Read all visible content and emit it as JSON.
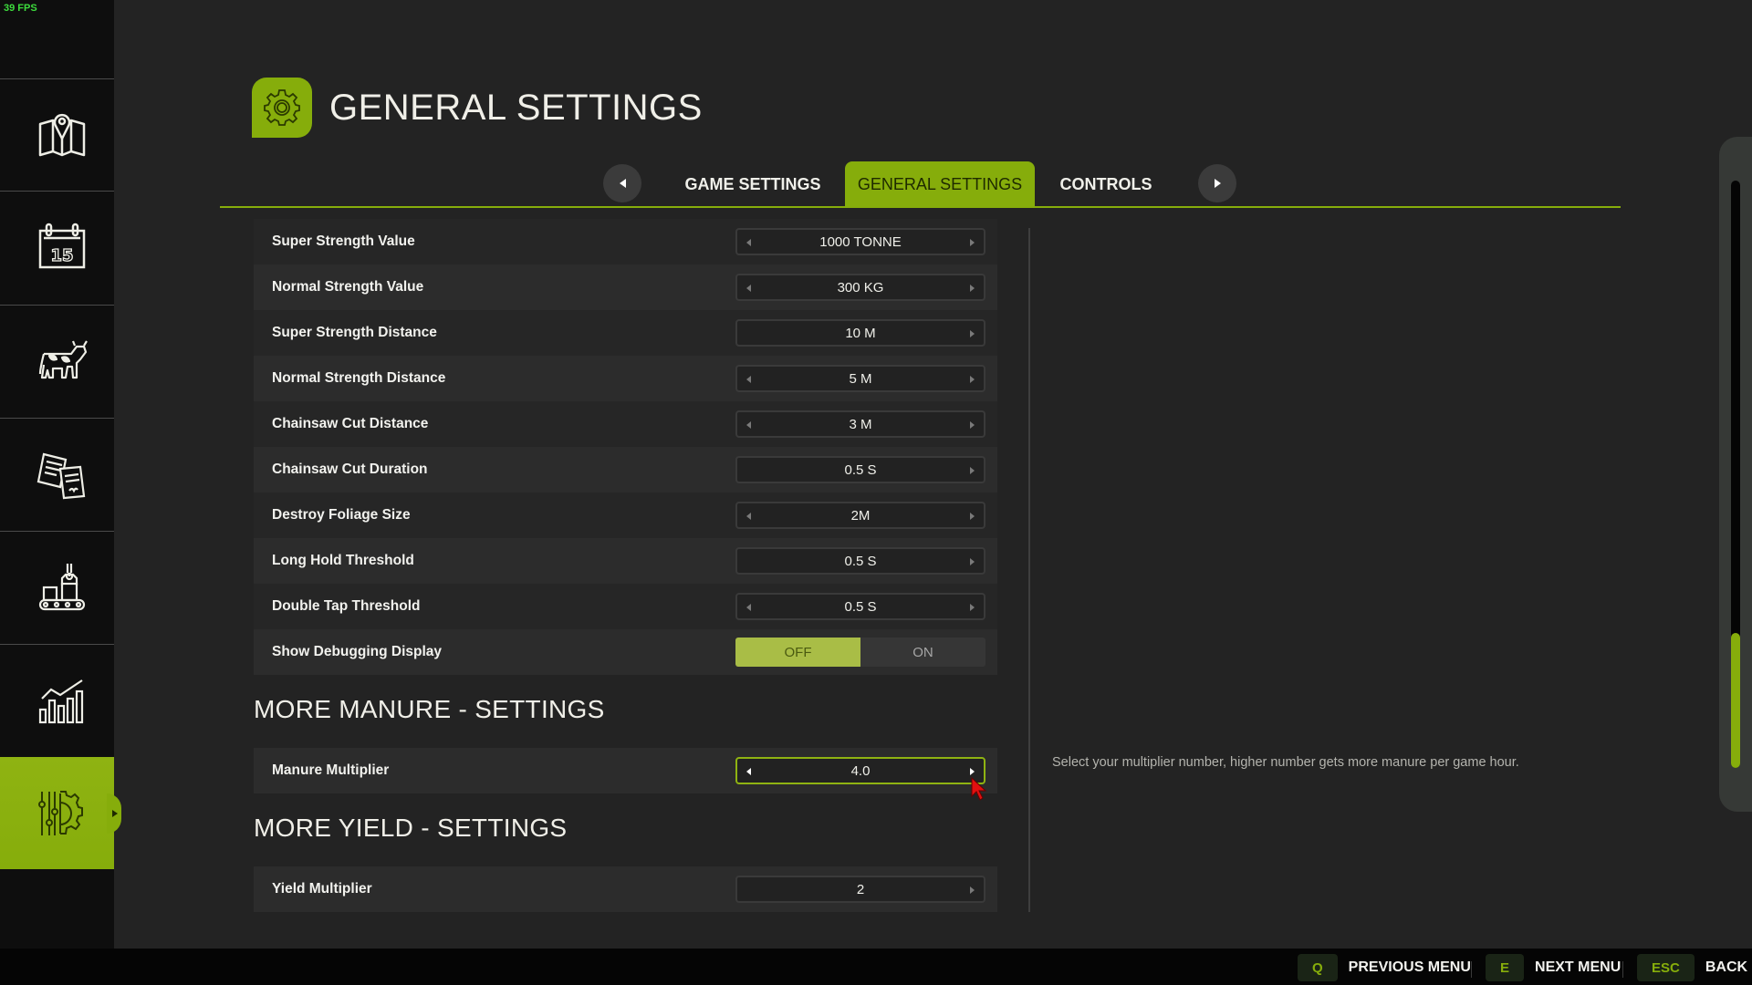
{
  "fps_counter": "39 FPS",
  "sidebar": {
    "items": [
      {
        "name": "map",
        "icon": "map-icon",
        "active": false
      },
      {
        "name": "calendar",
        "icon": "calendar-icon",
        "calendar_day": "15",
        "active": false
      },
      {
        "name": "animals",
        "icon": "cow-icon",
        "active": false
      },
      {
        "name": "contracts",
        "icon": "documents-icon",
        "active": false
      },
      {
        "name": "production",
        "icon": "factory-icon",
        "active": false
      },
      {
        "name": "statistics",
        "icon": "chart-icon",
        "active": false
      },
      {
        "name": "settings",
        "icon": "settings-gear-sliders-icon",
        "active": true
      }
    ]
  },
  "header": {
    "icon": "gear-icon",
    "title": "GENERAL SETTINGS"
  },
  "tabs": {
    "prev_icon": "triangle-left-icon",
    "next_icon": "triangle-right-icon",
    "items": [
      {
        "label": "GAME SETTINGS",
        "active": false
      },
      {
        "label": "GENERAL SETTINGS",
        "active": true
      },
      {
        "label": "CONTROLS",
        "active": false
      }
    ]
  },
  "settings": {
    "rows": [
      {
        "label": "Super Strength Value",
        "value": "1000 TONNE",
        "has_left": true,
        "has_right": true
      },
      {
        "label": "Normal Strength Value",
        "value": "300 KG",
        "has_left": true,
        "has_right": true
      },
      {
        "label": "Super Strength Distance",
        "value": "10 M",
        "has_left": false,
        "has_right": true
      },
      {
        "label": "Normal Strength Distance",
        "value": "5 M",
        "has_left": true,
        "has_right": true
      },
      {
        "label": "Chainsaw Cut Distance",
        "value": "3 M",
        "has_left": true,
        "has_right": true
      },
      {
        "label": "Chainsaw Cut Duration",
        "value": "0.5 S",
        "has_left": false,
        "has_right": true
      },
      {
        "label": "Destroy Foliage Size",
        "value": "2M",
        "has_left": true,
        "has_right": true
      },
      {
        "label": "Long Hold Threshold",
        "value": "0.5 S",
        "has_left": false,
        "has_right": true
      },
      {
        "label": "Double Tap Threshold",
        "value": "0.5 S",
        "has_left": true,
        "has_right": true
      }
    ],
    "debug_toggle": {
      "label": "Show Debugging Display",
      "off_label": "OFF",
      "on_label": "ON",
      "selected": "OFF"
    }
  },
  "manure_section": {
    "title": "MORE MANURE - SETTINGS",
    "row": {
      "label": "Manure Multiplier",
      "value": "4.0",
      "focused": true
    }
  },
  "yield_section": {
    "title": "MORE YIELD - SETTINGS",
    "row": {
      "label": "Yield Multiplier",
      "value": "2"
    }
  },
  "description": "Select your multiplier number, higher number gets more manure per game hour.",
  "scrollbar": {
    "position_fraction": 1.0,
    "visible_fraction": 0.23
  },
  "bottom_bar": {
    "hints": [
      {
        "key": "Q",
        "label": "PREVIOUS MENU"
      },
      {
        "key": "E",
        "label": "NEXT MENU"
      },
      {
        "key": "ESC",
        "label": "BACK"
      }
    ]
  },
  "colors": {
    "accent": "#86ad0b",
    "toggle_selected": "#a9bd46",
    "fps_text": "#3ddc3d",
    "background": "#232323",
    "sidebar": "#0e0e0e"
  }
}
